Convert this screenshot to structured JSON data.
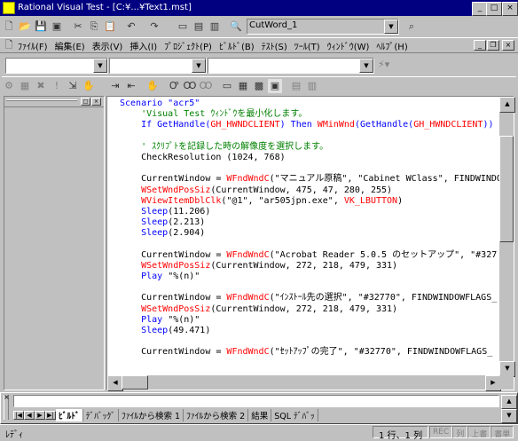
{
  "window": {
    "title": "Rational Visual Test - [C:¥...¥Text1.mst]"
  },
  "toolbar1": {
    "combo_value": "CutWord_1"
  },
  "menu": {
    "items": [
      "ﾌｧｲﾙ(F)",
      "編集(E)",
      "表示(V)",
      "挿入(I)",
      "ﾌﾟﾛｼﾞｪｸﾄ(P)",
      "ﾋﾞﾙﾄﾞ(B)",
      "ﾃｽﾄ(S)",
      "ﾂｰﾙ(T)",
      "ｳｨﾝﾄﾞｳ(W)",
      "ﾍﾙﾌﾟ(H)"
    ]
  },
  "code": {
    "lines": [
      [
        {
          "t": "Scenario \"acr5\"",
          "c": "kw"
        }
      ],
      [
        {
          "t": "    'Visual Test ｳｨﾝﾄﾞｳを最小化します。",
          "c": "cm"
        }
      ],
      [
        {
          "t": "    If GetHandle(",
          "c": "kw"
        },
        {
          "t": "GH_HWNDCLIENT",
          "c": "fn"
        },
        {
          "t": ") Then ",
          "c": "kw"
        },
        {
          "t": "WMinWnd",
          "c": "fn"
        },
        {
          "t": "(GetHandle(",
          "c": "kw"
        },
        {
          "t": "GH_HWNDCLIENT",
          "c": "fn"
        },
        {
          "t": "))",
          "c": "kw"
        }
      ],
      [
        {
          "t": "",
          "c": "nm"
        }
      ],
      [
        {
          "t": "    ' ｽｸﾘﾌﾟﾄを記録した時の解像度を選択します。",
          "c": "cm"
        }
      ],
      [
        {
          "t": "    CheckResolution (1024, 768)",
          "c": "nm"
        }
      ],
      [
        {
          "t": "",
          "c": "nm"
        }
      ],
      [
        {
          "t": "    CurrentWindow = ",
          "c": "nm"
        },
        {
          "t": "WFndWndC",
          "c": "fn"
        },
        {
          "t": "(\"マニュアル原稿\", \"Cabinet WClass\", FINDWINDO",
          "c": "nm"
        }
      ],
      [
        {
          "t": "    WSetWndPosSiz",
          "c": "fn"
        },
        {
          "t": "(CurrentWindow, 475, 47, 280, 255)",
          "c": "nm"
        }
      ],
      [
        {
          "t": "    WViewItemDblClk",
          "c": "fn"
        },
        {
          "t": "(\"@1\", \"ar505jpn.exe\", ",
          "c": "nm"
        },
        {
          "t": "VK_LBUTTON",
          "c": "fn"
        },
        {
          "t": ")",
          "c": "nm"
        }
      ],
      [
        {
          "t": "    Sleep",
          "c": "kw"
        },
        {
          "t": "(11.206)",
          "c": "nm"
        }
      ],
      [
        {
          "t": "    Sleep",
          "c": "kw"
        },
        {
          "t": "(2.213)",
          "c": "nm"
        }
      ],
      [
        {
          "t": "    Sleep",
          "c": "kw"
        },
        {
          "t": "(2.904)",
          "c": "nm"
        }
      ],
      [
        {
          "t": "",
          "c": "nm"
        }
      ],
      [
        {
          "t": "    CurrentWindow = ",
          "c": "nm"
        },
        {
          "t": "WFndWndC",
          "c": "fn"
        },
        {
          "t": "(\"Acrobat Reader 5.0.5 のセットアップ\", \"#327",
          "c": "nm"
        }
      ],
      [
        {
          "t": "    WSetWndPosSiz",
          "c": "fn"
        },
        {
          "t": "(CurrentWindow, 272, 218, 479, 331)",
          "c": "nm"
        }
      ],
      [
        {
          "t": "    Play",
          "c": "kw"
        },
        {
          "t": " \"%(n)\"",
          "c": "nm"
        }
      ],
      [
        {
          "t": "",
          "c": "nm"
        }
      ],
      [
        {
          "t": "    CurrentWindow = ",
          "c": "nm"
        },
        {
          "t": "WFndWndC",
          "c": "fn"
        },
        {
          "t": "(\"ｲﾝｽﾄｰﾙ先の選択\", \"#32770\", FINDWINDOWFLAGS_",
          "c": "nm"
        }
      ],
      [
        {
          "t": "    WSetWndPosSiz",
          "c": "fn"
        },
        {
          "t": "(CurrentWindow, 272, 218, 479, 331)",
          "c": "nm"
        }
      ],
      [
        {
          "t": "    Play",
          "c": "kw"
        },
        {
          "t": " \"%(n)\"",
          "c": "nm"
        }
      ],
      [
        {
          "t": "    Sleep",
          "c": "kw"
        },
        {
          "t": "(49.471)",
          "c": "nm"
        }
      ],
      [
        {
          "t": "",
          "c": "nm"
        }
      ],
      [
        {
          "t": "    CurrentWindow = ",
          "c": "nm"
        },
        {
          "t": "WFndWndC",
          "c": "fn"
        },
        {
          "t": "(\"ｾｯﾄｱｯﾌﾟの完了\", \"#32770\", FINDWINDOWFLAGS_",
          "c": "nm"
        }
      ]
    ]
  },
  "output_tabs": [
    "ﾋﾞﾙﾄﾞ",
    "ﾃﾞﾊﾞｯｸﾞ",
    "ﾌｧｲﾙから検索 1",
    "ﾌｧｲﾙから検索 2",
    "結果",
    "SQL ﾃﾞﾊﾞｯ"
  ],
  "status": {
    "left": "ﾚﾃﾞｨ",
    "position": "1 行、1 列",
    "indicators": [
      "REC",
      "列",
      "上書",
      "書単"
    ]
  },
  "colors": {
    "title_bg": "#000080",
    "keyword": "#0000ff",
    "comment": "#008000",
    "api": "#ff0000"
  }
}
